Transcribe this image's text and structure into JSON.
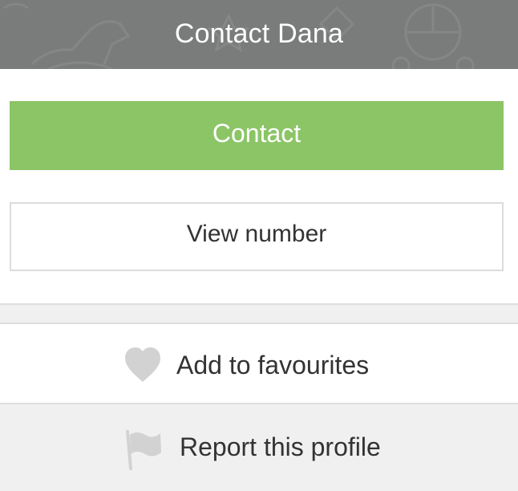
{
  "header": {
    "title": "Contact Dana"
  },
  "actions": {
    "contact_label": "Contact",
    "view_number_label": "View number"
  },
  "options": {
    "favourites": {
      "label": "Add to favourites",
      "icon": "heart-icon"
    },
    "report": {
      "label": "Report this profile",
      "icon": "flag-icon"
    }
  },
  "colors": {
    "header_bg": "#7a7b7b",
    "contact_green": "#8bc566",
    "icon_grey": "#d2d2d2",
    "row_grey": "#f0f0f0"
  }
}
